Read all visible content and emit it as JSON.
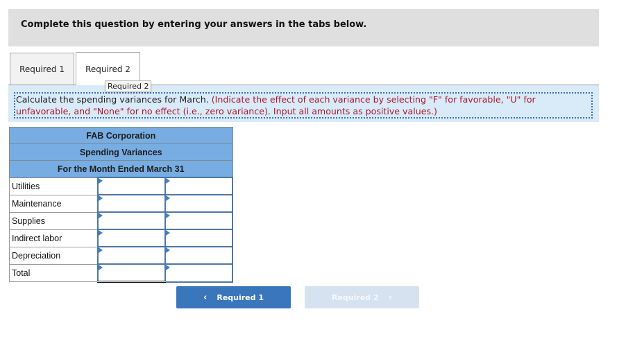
{
  "header": {
    "title": "Complete this question by entering your answers in the tabs below."
  },
  "tabs": [
    {
      "label": "Required 1",
      "active": false
    },
    {
      "label": "Required 2",
      "active": true
    }
  ],
  "tooltip": "Required 2",
  "instruction": {
    "main": "Calculate the spending variances for March.",
    "note": "(Indicate the effect of each variance by selecting \"F\" for favorable, \"U\" for unfavorable, and \"None\" for no effect (i.e., zero variance). Input all amounts as positive values.)"
  },
  "report": {
    "company": "FAB Corporation",
    "title": "Spending Variances",
    "period": "For the Month Ended March 31",
    "rows": [
      {
        "label": "Utilities",
        "amount": "",
        "effect": ""
      },
      {
        "label": "Maintenance",
        "amount": "",
        "effect": ""
      },
      {
        "label": "Supplies",
        "amount": "",
        "effect": ""
      },
      {
        "label": "Indirect labor",
        "amount": "",
        "effect": ""
      },
      {
        "label": "Depreciation",
        "amount": "",
        "effect": ""
      },
      {
        "label": "Total",
        "amount": "",
        "effect": ""
      }
    ]
  },
  "navigation": {
    "prev_label": "Required 1",
    "next_label": "Required 2",
    "prev_icon": "chevron-left-icon",
    "next_icon": "chevron-right-icon"
  },
  "colors": {
    "header_bg": "#dfdfdf",
    "instruction_bg": "#d9eaf8",
    "instruction_note": "#a8182c",
    "report_header_bg": "#77ade2",
    "input_border": "#4d76ab",
    "prev_button": "#3a76bb",
    "next_button_disabled": "#d6e2f0"
  }
}
